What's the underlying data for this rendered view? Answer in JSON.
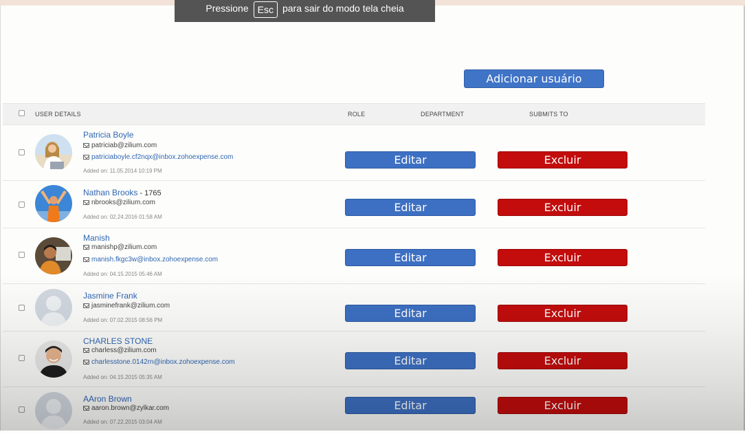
{
  "fullscreen_toast": {
    "prefix": "Pressione",
    "key": "Esc",
    "suffix": "para sair do modo tela cheia"
  },
  "toolbar": {
    "add_user_label": "Adicionar usuário"
  },
  "table": {
    "columns": {
      "user_details": "USER DETAILS",
      "role": "ROLE",
      "department": "DEPARTMENT",
      "submits_to": "SUBMITS TO"
    },
    "rows": [
      {
        "name": "Patricia Boyle",
        "name_suffix": "",
        "email": "patriciab@zilium.com",
        "forward_email": "patriciaboyle.cf2nqx@inbox.zohoexpense.com",
        "added": "Added on: 11.05.2014 10:19 PM",
        "edit_label": "Editar",
        "delete_label": "Excluir",
        "avatar": "photo-woman-laptop"
      },
      {
        "name": "Nathan Brooks",
        "name_suffix": " - 1765",
        "email": "nbrooks@zilium.com",
        "forward_email": "",
        "added": "Added on: 02.24.2016 01:58 AM",
        "edit_label": "Editar",
        "delete_label": "Excluir",
        "avatar": "photo-man-arms-raised"
      },
      {
        "name": "Manish",
        "name_suffix": "",
        "email": "manishp@zilium.com",
        "forward_email": "manish.fkgc3w@inbox.zohoexpense.com",
        "added": "Added on: 04.15.2015 05:46 AM",
        "edit_label": "Editar",
        "delete_label": "Excluir",
        "avatar": "photo-man-computer"
      },
      {
        "name": "Jasmine Frank",
        "name_suffix": "",
        "email": "jasminefrank@zilium.com",
        "forward_email": "",
        "added": "Added on: 07.02.2015 08:56 PM",
        "edit_label": "Editar",
        "delete_label": "Excluir",
        "avatar": "placeholder-avatar"
      },
      {
        "name": "CHARLES STONE",
        "name_suffix": "",
        "email": "charless@zilium.com",
        "forward_email": "charlesstone.0142rn@inbox.zohoexpense.com",
        "added": "Added on: 04.15.2015 05:35 AM",
        "edit_label": "Editar",
        "delete_label": "Excluir",
        "avatar": "photo-man-smiling"
      },
      {
        "name": "AAron Brown",
        "name_suffix": "",
        "email": "aaron.brown@zylkar.com",
        "forward_email": "",
        "added": "Added on: 07.22.2015 03:04 AM",
        "edit_label": "Editar",
        "delete_label": "Excluir",
        "avatar": "placeholder-avatar"
      }
    ]
  },
  "colors": {
    "edit": "#3d70c3",
    "delete": "#c30c0c",
    "link": "#2f66b3"
  }
}
